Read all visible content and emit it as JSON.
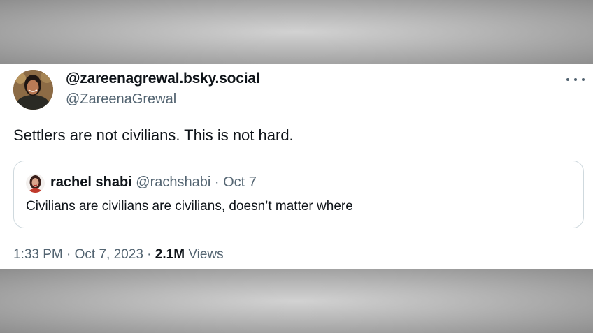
{
  "author": {
    "display_handle": "@zareenagrewal.bsky.social",
    "handle": "@ZareenaGrewal"
  },
  "tweet": {
    "text": "Settlers are not civilians. This is not hard."
  },
  "quoted_tweet": {
    "name": "rachel shabi",
    "handle": "@rachshabi",
    "separator": "·",
    "date": "Oct 7",
    "text": "Civilians are civilians are civilians, doesn’t matter where"
  },
  "meta": {
    "time": "1:33 PM",
    "separator": "·",
    "date": "Oct 7, 2023",
    "views_count": "2.1M",
    "views_label": "Views"
  },
  "icons": {
    "more": "more-options-icon"
  },
  "colors": {
    "text_primary": "#0f1419",
    "text_secondary": "#536471",
    "border": "#cfd9de",
    "background_band": "#b8b8b8"
  }
}
